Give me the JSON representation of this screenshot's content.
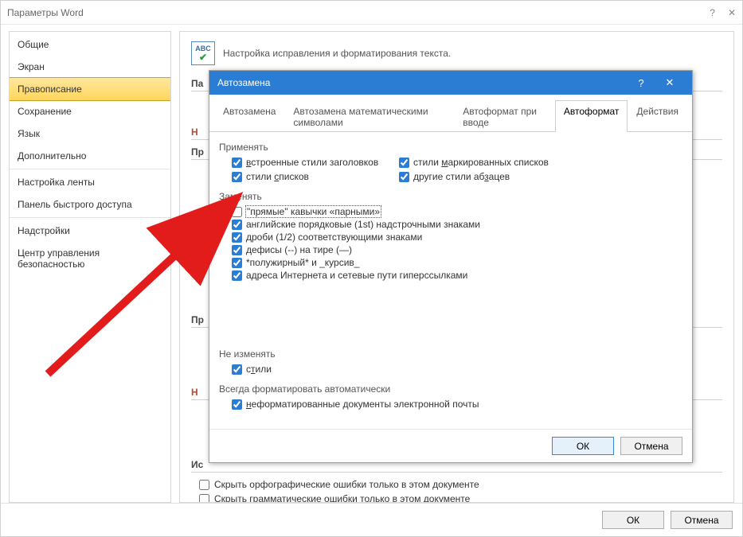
{
  "parent": {
    "title": "Параметры Word",
    "sidebar": {
      "items": [
        {
          "label": "Общие"
        },
        {
          "label": "Экран"
        },
        {
          "label": "Правописание",
          "selected": true
        },
        {
          "label": "Сохранение"
        },
        {
          "label": "Язык"
        },
        {
          "label": "Дополнительно"
        }
      ],
      "sep": true,
      "items2": [
        {
          "label": "Настройка ленты"
        },
        {
          "label": "Панель быстрого доступа"
        }
      ],
      "sep2": true,
      "items3": [
        {
          "label": "Надстройки"
        },
        {
          "label": "Центр управления безопасностью"
        }
      ]
    },
    "section_title": "Настройка исправления и форматирования текста.",
    "groups": {
      "g1": "Па",
      "g2": "Н",
      "g3": "Пр",
      "g4": "Пр",
      "g5": "Н",
      "g6": "Ис"
    },
    "bottom_checks": [
      {
        "label": "Скрыть орфографические ошибки только в этом документе",
        "checked": false
      },
      {
        "label": "Скрыть грамматические ошибки только в этом документе",
        "checked": false
      }
    ],
    "buttons": {
      "ok": "ОК",
      "cancel": "Отмена"
    }
  },
  "modal": {
    "title": "Автозамена",
    "tabs": [
      {
        "label": "Автозамена"
      },
      {
        "label": "Автозамена математическими символами"
      },
      {
        "label": "Автоформат при вводе"
      },
      {
        "label": "Автоформат",
        "active": true
      },
      {
        "label": "Действия"
      }
    ],
    "apply": {
      "label": "Применять",
      "items_left": [
        {
          "label_pre": "",
          "u": "в",
          "label_post": "строенные стили заголовков",
          "checked": true
        },
        {
          "label_pre": "стили ",
          "u": "с",
          "label_post": "писков",
          "checked": true
        }
      ],
      "items_right": [
        {
          "label_pre": "стили ",
          "u": "м",
          "label_post": "аркированных списков",
          "checked": true
        },
        {
          "label_pre": "другие стили аб",
          "u": "з",
          "label_post": "ацев",
          "checked": true
        }
      ]
    },
    "replace": {
      "label": "Заменять",
      "items": [
        {
          "label": "\"прямые\" кавычки «парными»",
          "checked": false,
          "focused": true
        },
        {
          "label": "английские порядковые (1st) надстрочными знаками",
          "checked": true
        },
        {
          "label": "дроби (1/2) соответствующими знаками",
          "checked": true
        },
        {
          "label": "дефисы (--) на тире (—)",
          "checked": true
        },
        {
          "label": "*полужирный* и _курсив_",
          "checked": true
        },
        {
          "label": "адреса Интернета и сетевые пути гиперссылками",
          "checked": true
        }
      ]
    },
    "preserve": {
      "label": "Не изменять",
      "items": [
        {
          "label_pre": "с",
          "u": "т",
          "label_post": "или",
          "checked": true
        }
      ]
    },
    "always": {
      "label": "Всегда форматировать автоматически",
      "items": [
        {
          "label_pre": "",
          "u": "н",
          "label_post": "еформатированные документы электронной почты",
          "checked": true
        }
      ]
    },
    "buttons": {
      "ok": "ОК",
      "cancel": "Отмена"
    }
  }
}
